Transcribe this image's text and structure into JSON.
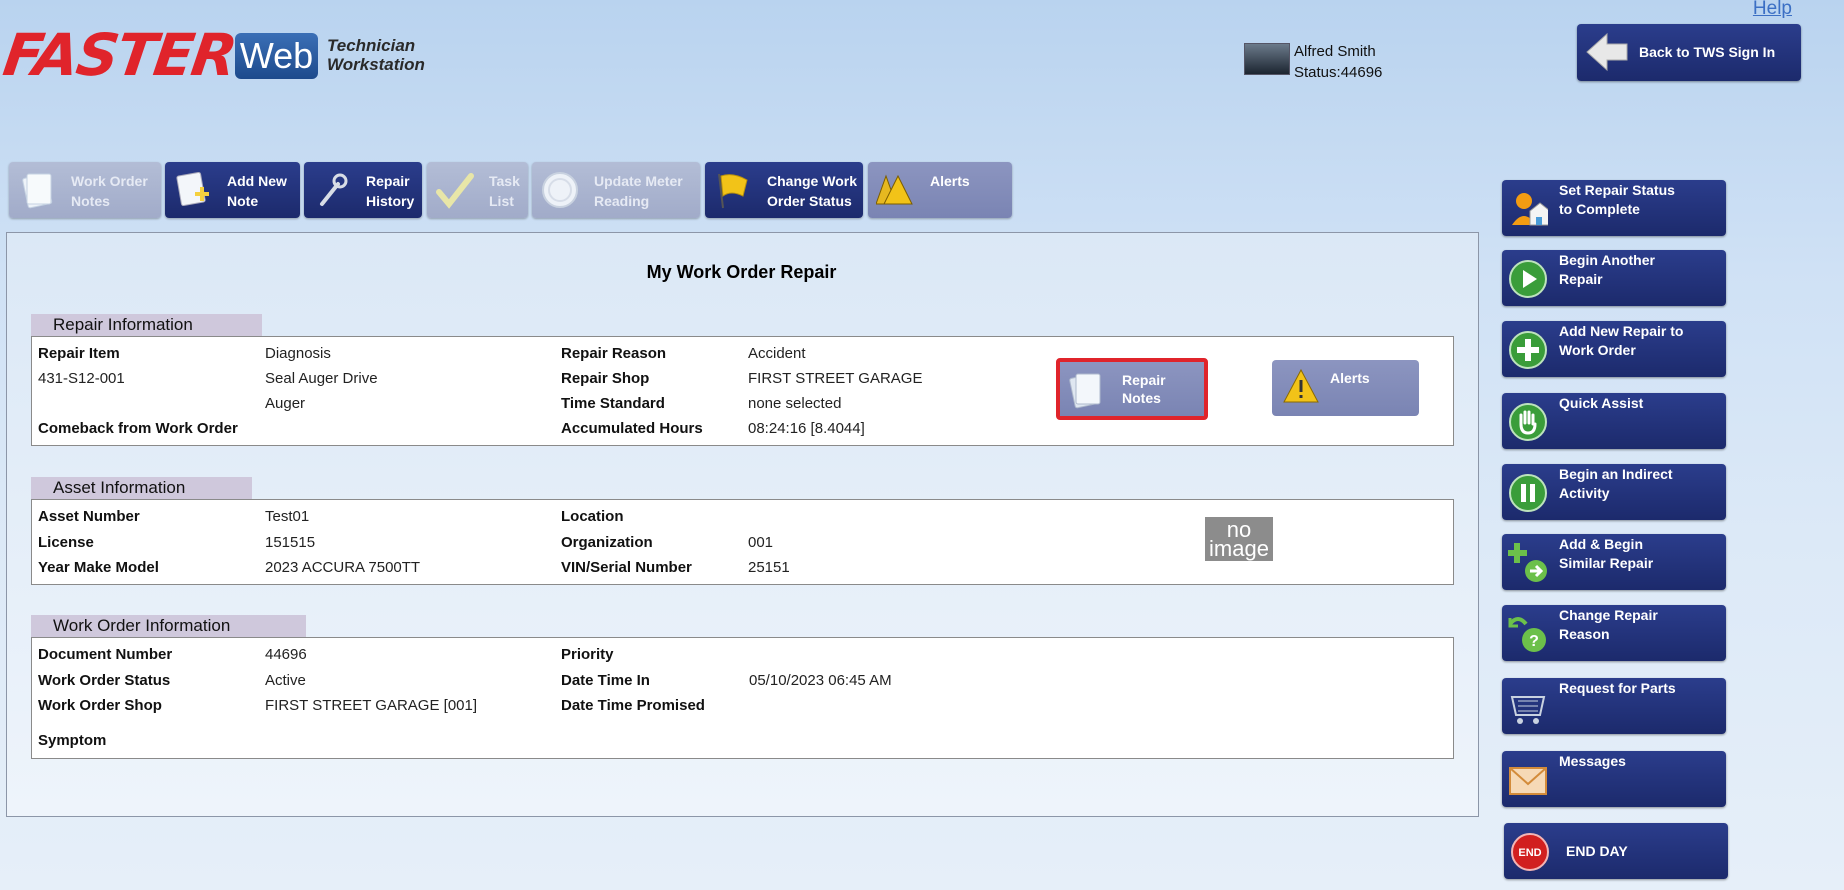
{
  "logo": {
    "brand": "FASTER",
    "web": "Web",
    "sub_line1": "Technician",
    "sub_line2": "Workstation"
  },
  "help": {
    "label": "Help"
  },
  "user": {
    "name": "Alfred Smith",
    "status": "Status:44696"
  },
  "back_button": {
    "label": "Back to TWS Sign In"
  },
  "toolbar": [
    {
      "label": "Work Order\nNotes",
      "state": "disabled",
      "icon": "notes-icon"
    },
    {
      "label": "Add New\nNote",
      "state": "active",
      "icon": "add-note-icon"
    },
    {
      "label": "Repair\nHistory",
      "state": "active",
      "icon": "wrench-icon"
    },
    {
      "label": "Task\nList",
      "state": "disabled",
      "icon": "checkmark-icon"
    },
    {
      "label": "Update Meter\nReading",
      "state": "disabled",
      "icon": "gauge-icon"
    },
    {
      "label": "Change Work\nOrder Status",
      "state": "active",
      "icon": "flag-icon"
    },
    {
      "label": "Alerts",
      "state": "grey",
      "icon": "warning-icon"
    }
  ],
  "main": {
    "title": "My Work Order Repair",
    "repair_info": {
      "title": "Repair Information",
      "repair_item_label": "Repair Item",
      "repair_item_value": "Diagnosis",
      "repair_code": "431-S12-001",
      "repair_desc_1": "Seal Auger Drive",
      "repair_desc_2": "Auger",
      "comeback_label": "Comeback from Work Order",
      "repair_reason_label": "Repair Reason",
      "repair_reason_value": "Accident",
      "repair_shop_label": "Repair Shop",
      "repair_shop_value": "FIRST STREET GARAGE",
      "time_standard_label": "Time Standard",
      "time_standard_value": "none selected",
      "accumulated_label": "Accumulated Hours",
      "accumulated_value": "08:24:16 [8.4044]",
      "repair_notes_button": "Repair\nNotes",
      "alerts_button": "Alerts"
    },
    "asset_info": {
      "title": "Asset Information",
      "asset_number_label": "Asset Number",
      "asset_number_value": "Test01",
      "license_label": "License",
      "license_value": "151515",
      "ymm_label": "Year Make Model",
      "ymm_value": "2023 ACCURA 7500TT",
      "location_label": "Location",
      "organization_label": "Organization",
      "organization_value": "001",
      "vin_label": "VIN/Serial Number",
      "vin_value": "25151",
      "no_image_1": "no",
      "no_image_2": "image"
    },
    "work_order_info": {
      "title": "Work Order Information",
      "doc_number_label": "Document Number",
      "doc_number_value": "44696",
      "wo_status_label": "Work Order Status",
      "wo_status_value": "Active",
      "wo_shop_label": "Work Order Shop",
      "wo_shop_value": "FIRST STREET GARAGE [001]",
      "symptom_label": "Symptom",
      "priority_label": "Priority",
      "date_in_label": "Date Time In",
      "date_in_value": "05/10/2023 06:45 AM",
      "date_promised_label": "Date Time Promised"
    }
  },
  "side_buttons": [
    {
      "label": "Set Repair Status\nto Complete",
      "icon": "complete-status-icon"
    },
    {
      "label": "Begin Another\nRepair",
      "icon": "play-icon"
    },
    {
      "label": "Add New Repair to\nWork Order",
      "icon": "plus-icon"
    },
    {
      "label": "Quick Assist",
      "icon": "hand-icon"
    },
    {
      "label": "Begin an Indirect\nActivity",
      "icon": "pause-icon"
    },
    {
      "label": "Add & Begin\nSimilar Repair",
      "icon": "add-begin-icon"
    },
    {
      "label": "Change Repair\nReason",
      "icon": "question-icon"
    },
    {
      "label": "Request for Parts",
      "icon": "parts-cart-icon"
    },
    {
      "label": "Messages",
      "icon": "envelope-icon"
    },
    {
      "label": "END DAY",
      "icon": "end-icon",
      "badge": "END"
    }
  ],
  "colors": {
    "accent": "#1c2a6c",
    "brand_red": "#e0242b",
    "highlight": "#e0242b"
  }
}
